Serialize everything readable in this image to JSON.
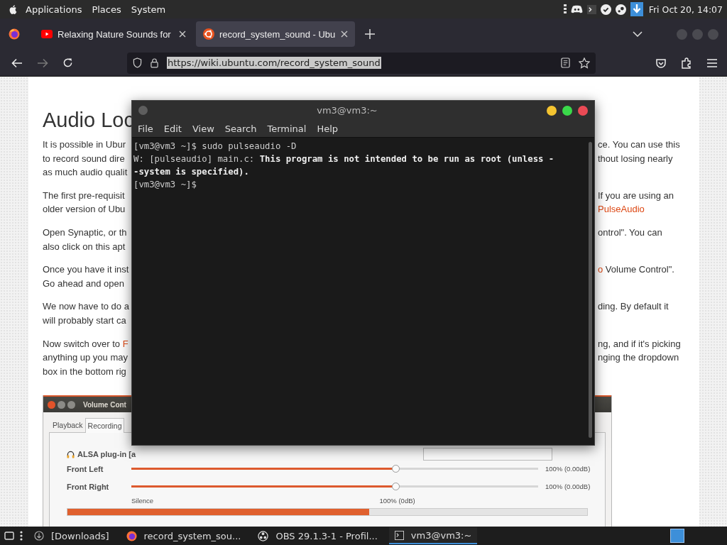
{
  "top_bar": {
    "menus": [
      "Applications",
      "Places",
      "System"
    ],
    "clock": "Fri Oct 20, 14:07"
  },
  "browser": {
    "tabs": [
      {
        "title": "Relaxing Nature Sounds for",
        "selected": false,
        "kind": "video"
      },
      {
        "title": "record_system_sound - Ubu",
        "selected": true,
        "kind": "wiki"
      }
    ],
    "forward_disabled": true,
    "url": "https://wiki.ubuntu.com/record_system_sound",
    "url_selected": true
  },
  "page": {
    "heading": "Audio Loc",
    "paragraphs": [
      {
        "lines": [
          {
            "left": [
              {
                "text": "It is possible in Ubur"
              }
            ],
            "right": [
              {
                "text": "ce. You can use this"
              }
            ]
          },
          {
            "left": [
              {
                "text": "to record sound dire"
              }
            ],
            "right": [
              {
                "text": "thout losing nearly"
              }
            ]
          },
          {
            "left": [
              {
                "text": "as much audio qualit"
              }
            ]
          }
        ]
      },
      {
        "lines": [
          {
            "left": [
              {
                "text": "The first pre-requisit"
              }
            ],
            "right": [
              {
                "text": "If you are using an"
              }
            ]
          },
          {
            "left": [
              {
                "text": "older version of Ubu"
              }
            ],
            "right": [
              {
                "text": "PulseAudio",
                "link": true
              }
            ]
          }
        ]
      },
      {
        "lines": [
          {
            "left": [
              {
                "text": "Open Synaptic, or th"
              }
            ],
            "right": [
              {
                "text": "ontrol\". You can"
              }
            ]
          },
          {
            "left": [
              {
                "text": "also click on this apt"
              }
            ]
          }
        ]
      },
      {
        "lines": [
          {
            "left": [
              {
                "text": "Once you have it inst"
              }
            ],
            "right": [
              {
                "text": "o",
                "link": true
              },
              {
                "text": " Volume Control\"."
              }
            ]
          },
          {
            "left": [
              {
                "text": "Go ahead and open"
              }
            ]
          }
        ]
      },
      {
        "lines": [
          {
            "left": [
              {
                "text": "We now have to do a"
              }
            ],
            "right": [
              {
                "text": "ding. By default it"
              }
            ]
          },
          {
            "left": [
              {
                "text": "will probably start ca"
              }
            ]
          }
        ]
      },
      {
        "lines": [
          {
            "left": [
              {
                "text": "Now switch over to "
              },
              {
                "text": "F",
                "link": true
              }
            ],
            "right": [
              {
                "text": "ng, and if it's picking"
              }
            ]
          },
          {
            "left": [
              {
                "text": "anything up you may"
              }
            ],
            "right": [
              {
                "text": "nging the dropdown"
              }
            ]
          },
          {
            "left": [
              {
                "text": "box in the bottom rig"
              }
            ]
          }
        ]
      }
    ],
    "screenshot": {
      "title": "Volume Cont",
      "tabs": [
        {
          "label": "Playback",
          "selected": false
        },
        {
          "label": "Recording",
          "selected": true
        }
      ],
      "device": "ALSA plug-in [a",
      "channels": [
        {
          "name": "Front Left",
          "level": 0.65,
          "reading": "100% (0.00dB)"
        },
        {
          "name": "Front Right",
          "level": 0.65,
          "reading": "100% (0.00dB)"
        }
      ],
      "scale": [
        "Silence",
        "100% (0dB)"
      ],
      "meter": {
        "level": 0.58
      }
    }
  },
  "terminal": {
    "title": "vm3@vm3:~",
    "menus": [
      "File",
      "Edit",
      "View",
      "Search",
      "Terminal",
      "Help"
    ],
    "lines": [
      {
        "text": "[vm3@vm3 ~]$ sudo pulseaudio -D",
        "bold": false
      },
      {
        "text": "W: [pulseaudio] main.c: **This program is not intended to be run as root (unless -**",
        "bold": false
      },
      {
        "text": "-system is specified).",
        "bold": true
      },
      {
        "text": "[vm3@vm3 ~]$",
        "bold": false
      }
    ]
  },
  "taskbar": {
    "items": [
      {
        "label": "[Downloads]",
        "kind": "folder",
        "selected": false
      },
      {
        "label": "record_system_sou...",
        "kind": "browser",
        "selected": false
      },
      {
        "label": "OBS 29.1.3-1 - Profil...",
        "kind": "obs",
        "selected": false
      },
      {
        "label": "vm3@vm3:~",
        "kind": "terminal",
        "selected": true
      }
    ]
  }
}
